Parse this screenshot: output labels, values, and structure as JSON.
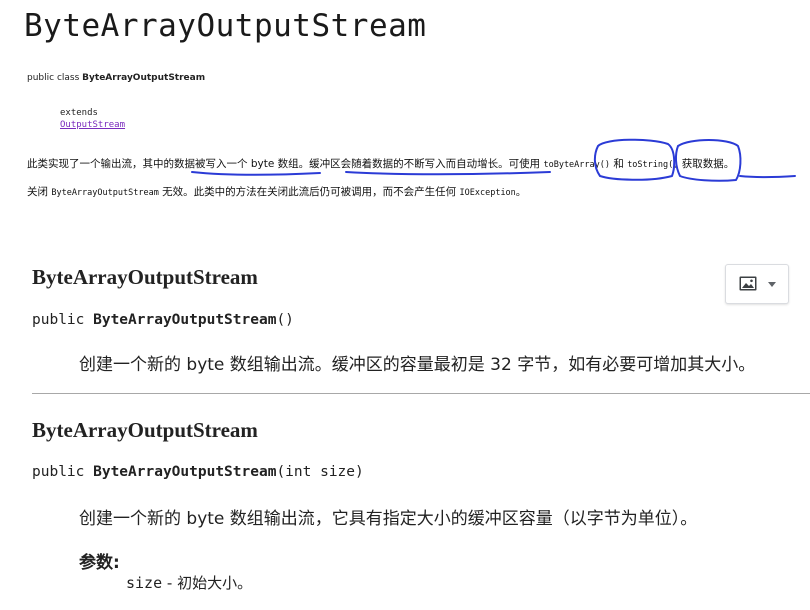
{
  "page": {
    "title": "ByteArrayOutputStream"
  },
  "class_declaration": {
    "modifiers": "public class",
    "name": "ByteArrayOutputStream",
    "extends_keyword": "extends",
    "superclass": "OutputStream"
  },
  "description": {
    "line1": [
      {
        "text": "此类实现了一个输出流，其中的数据被写入一个 byte 数组。缓冲区会随着数据的不断写入而自动增长。可使用 ",
        "code": false
      },
      {
        "text": "toByteArray()",
        "code": true
      },
      {
        "text": " 和 ",
        "code": false
      },
      {
        "text": "toString()",
        "code": true
      },
      {
        "text": " 获取数据。",
        "code": false
      }
    ],
    "line2": [
      {
        "text": "关闭 ",
        "code": false
      },
      {
        "text": "ByteArrayOutputStream",
        "code": true
      },
      {
        "text": " 无效。此类中的方法在关闭此流后仍可被调用，而不会产生任何 ",
        "code": false
      },
      {
        "text": "IOException",
        "code": true
      },
      {
        "text": "。",
        "code": false
      }
    ]
  },
  "constructors": [
    {
      "heading": "ByteArrayOutputStream",
      "sig_prefix": "public ",
      "sig_name": "ByteArrayOutputStream",
      "sig_params": "()",
      "description": "创建一个新的 byte 数组输出流。缓冲区的容量最初是 32 字节，如有必要可增加其大小。"
    },
    {
      "heading": "ByteArrayOutputStream",
      "sig_prefix": "public ",
      "sig_name": "ByteArrayOutputStream",
      "sig_params": "(int size)",
      "description": "创建一个新的 byte 数组输出流，它具有指定大小的缓冲区容量（以字节为单位）。",
      "params_label": "参数:",
      "param_name": "size",
      "param_desc": " - 初始大小。"
    }
  ],
  "colors": {
    "link": "#7a2bbd",
    "annotation_ink": "#2b3bd6"
  },
  "icons": {
    "image_button": "image-icon",
    "dropdown": "caret-down-icon"
  }
}
